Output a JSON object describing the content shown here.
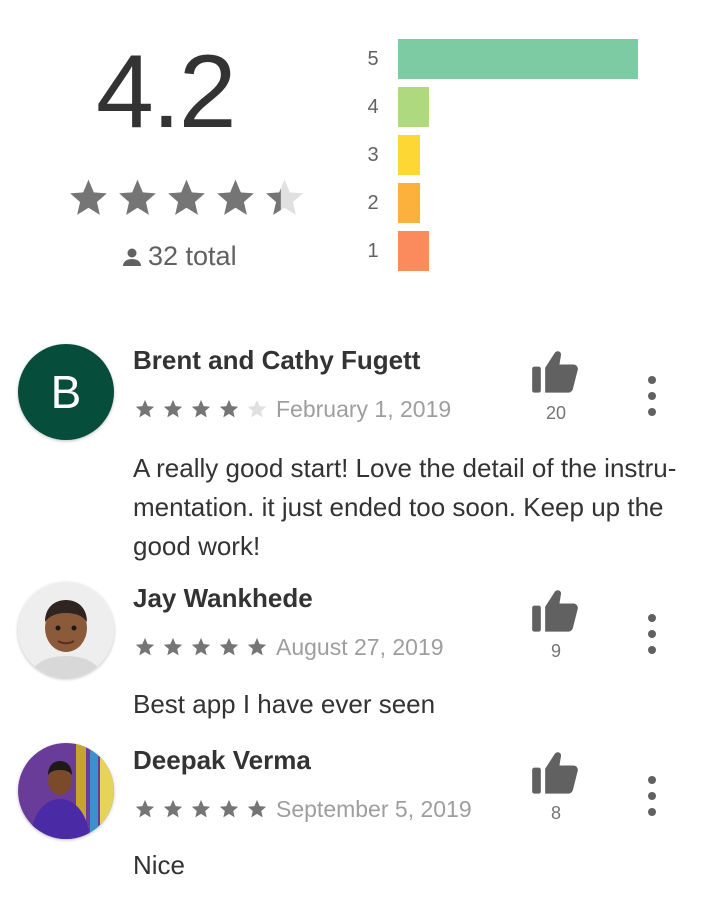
{
  "summary": {
    "average": "4.2",
    "stars": 4.2,
    "total_label": "32 total",
    "histogram": [
      {
        "label": "5",
        "fraction": 1.0,
        "color": "#7ccba2"
      },
      {
        "label": "4",
        "fraction": 0.13,
        "color": "#aed97f"
      },
      {
        "label": "3",
        "fraction": 0.09,
        "color": "#fdd835"
      },
      {
        "label": "2",
        "fraction": 0.09,
        "color": "#fbb13c"
      },
      {
        "label": "1",
        "fraction": 0.13,
        "color": "#fb8a5c"
      }
    ]
  },
  "reviews": [
    {
      "author": "Brent and Cathy Fugett",
      "avatar_letter": "B",
      "stars": 4,
      "date": "February 1, 2019",
      "likes": "20",
      "text": "A really good start! Love the detail of the instru-mentation. it just ended too soon. Keep up the good work!"
    },
    {
      "author": "Jay Wankhede",
      "avatar_icon": "profile-photo",
      "stars": 5,
      "date": "August 27, 2019",
      "likes": "9",
      "text": "Best app I have ever seen"
    },
    {
      "author": "Deepak Verma",
      "avatar_icon": "profile-photo",
      "stars": 5,
      "date": "September 5, 2019",
      "likes": "8",
      "text": "Nice"
    }
  ],
  "icons": {
    "star": "star-icon",
    "person": "person-icon",
    "thumb": "thumb-up-icon",
    "menu": "more-vert-icon"
  },
  "colors": {
    "star_filled": "#757575",
    "star_empty": "#e0e0e0"
  }
}
